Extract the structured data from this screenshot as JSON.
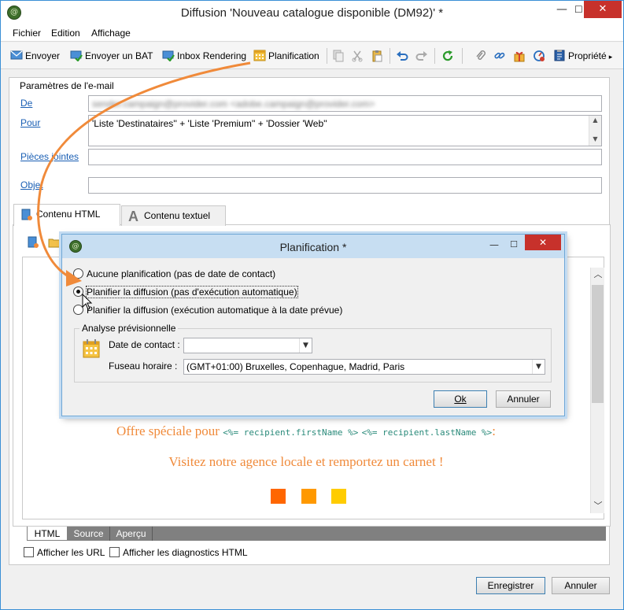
{
  "window": {
    "title": "Diffusion 'Nouveau catalogue disponible (DM92)' *",
    "minimize_glyph": "—",
    "maximize_glyph": "☐",
    "close_glyph": "✕"
  },
  "menu": [
    "Fichier",
    "Edition",
    "Affichage"
  ],
  "toolbar": {
    "send": "Envoyer",
    "send_proof": "Envoyer un BAT",
    "inbox_rendering": "Inbox Rendering",
    "schedule": "Planification",
    "properties": "Propriété"
  },
  "email_params": {
    "section_title": "Paramètres de l'e-mail",
    "from_label": "De",
    "from_value": "sender.campaign@provider.com <adobe.campaign@provider.com>",
    "to_label": "Pour",
    "to_value": "'Liste 'Destinataires'' + 'Liste 'Premium'' + 'Dossier 'Web''",
    "attachments_label": "Pièces jointes",
    "subject_label": "Objet"
  },
  "tabs": {
    "html": "Contenu HTML",
    "text": "Contenu textuel"
  },
  "content": {
    "offer_prefix": "Offre spéciale pour",
    "code_first": "<%= recipient.firstName %>",
    "code_last": "<%= recipient.lastName %>",
    "offer_suffix": ":",
    "visit": "Visitez notre agence locale et remportez un carnet !",
    "squares": [
      "#ff6600",
      "#ff9900",
      "#ffcc00"
    ]
  },
  "bottom_tabs": [
    "HTML",
    "Source",
    "Aperçu"
  ],
  "checkboxes": {
    "show_urls": "Afficher les URL",
    "show_diagnostics": "Afficher les diagnostics HTML"
  },
  "buttons": {
    "save": "Enregistrer",
    "cancel": "Annuler"
  },
  "dialog": {
    "title": "Planification *",
    "option_none": "Aucune planification (pas de date de contact)",
    "option_manual": "Planifier la diffusion (pas d'exécution automatique)",
    "option_auto": "Planifier la diffusion (exécution automatique à la date prévue)",
    "selected_option": "option_manual",
    "forecast_title": "Analyse prévisionnelle",
    "contact_date_label": "Date de contact :",
    "contact_date_value": "",
    "timezone_label": "Fuseau horaire :",
    "timezone_value": "(GMT+01:00) Bruxelles, Copenhague, Madrid, Paris",
    "ok": "Ok",
    "cancel": "Annuler"
  },
  "colors": {
    "annotation_arrow": "#f08a3a",
    "link": "#1a5fb4",
    "window_border": "#3a8fd6"
  }
}
